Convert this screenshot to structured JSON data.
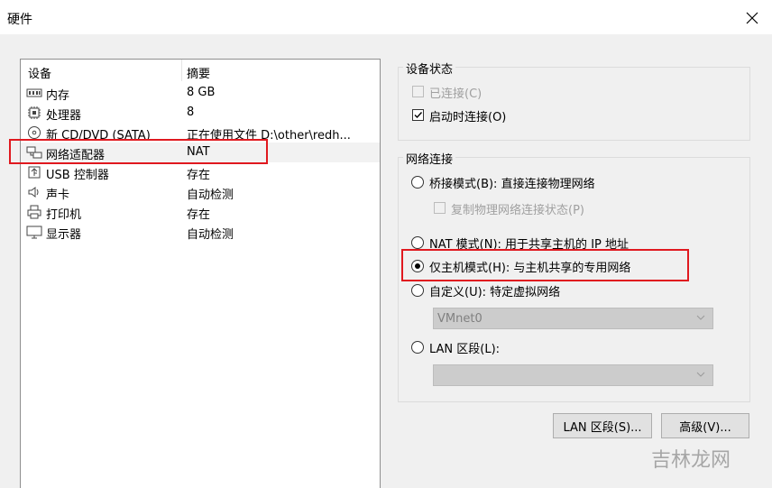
{
  "window": {
    "title": "硬件"
  },
  "device_list": {
    "col_device": "设备",
    "col_summary": "摘要",
    "items": [
      {
        "icon": "memory-icon",
        "name": "内存",
        "summary": "8 GB"
      },
      {
        "icon": "cpu-icon",
        "name": "处理器",
        "summary": "8"
      },
      {
        "icon": "cd-icon",
        "name": "新 CD/DVD (SATA)",
        "summary": "正在使用文件 D:\\other\\redh..."
      },
      {
        "icon": "network-icon",
        "name": "网络适配器",
        "summary": "NAT"
      },
      {
        "icon": "usb-icon",
        "name": "USB 控制器",
        "summary": "存在"
      },
      {
        "icon": "sound-icon",
        "name": "声卡",
        "summary": "自动检测"
      },
      {
        "icon": "printer-icon",
        "name": "打印机",
        "summary": "存在"
      },
      {
        "icon": "display-icon",
        "name": "显示器",
        "summary": "自动检测"
      }
    ],
    "selected_index": 3
  },
  "device_status": {
    "title": "设备状态",
    "connected_label": "已连接(C)",
    "connected": false,
    "connect_at_poweron_label": "启动时连接(O)",
    "connect_at_poweron": true
  },
  "network_connection": {
    "title": "网络连接",
    "bridged_label": "桥接模式(B): 直接连接物理网络",
    "replicate_label": "复制物理网络连接状态(P)",
    "nat_label": "NAT 模式(N): 用于共享主机的 IP 地址",
    "hostonly_label": "仅主机模式(H): 与主机共享的专用网络",
    "custom_label": "自定义(U): 特定虚拟网络",
    "custom_value": "VMnet0",
    "lan_label": "LAN 区段(L):",
    "lan_value": "",
    "selected": "hostonly"
  },
  "buttons": {
    "lan_segments": "LAN 区段(S)...",
    "advanced": "高级(V)..."
  },
  "watermark": "吉林龙网",
  "colors": {
    "highlight": "#e0191f"
  }
}
